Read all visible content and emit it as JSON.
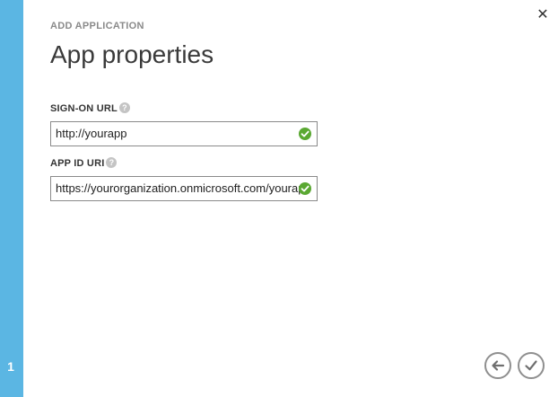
{
  "wizard": {
    "step_number": "1",
    "subtitle": "ADD APPLICATION",
    "title": "App properties"
  },
  "fields": {
    "sign_on_url": {
      "label": "SIGN-ON URL",
      "value": "http://yourapp",
      "valid": true
    },
    "app_id_uri": {
      "label": "APP ID URI",
      "value": "https://yourorganization.onmicrosoft.com/yourap",
      "valid": true
    }
  },
  "icons": {
    "close": "close-icon",
    "help": "help-icon",
    "valid": "checkmark-circle-icon",
    "back": "arrow-left-circle-icon",
    "complete": "check-circle-icon"
  },
  "colors": {
    "sidebar": "#5bb6e3",
    "valid_check": "#5aa832",
    "button_border": "#8f8f8f"
  }
}
